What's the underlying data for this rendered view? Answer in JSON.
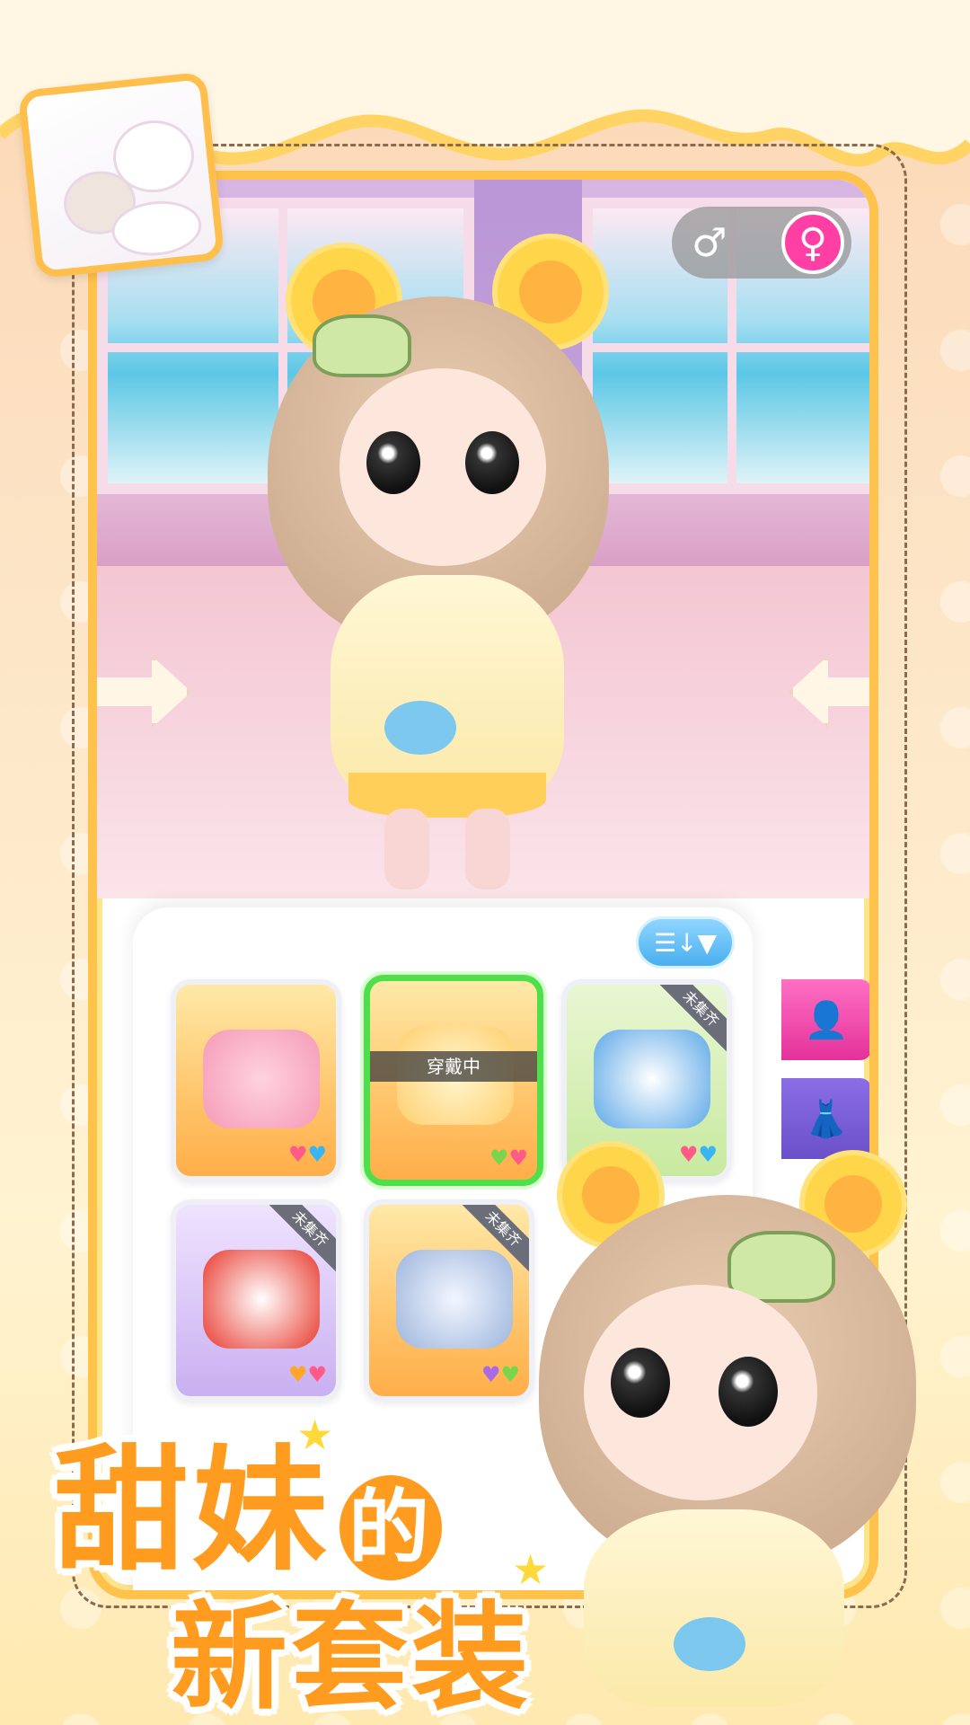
{
  "gender_toggle": {
    "male_symbol": "♂",
    "female_symbol": "♀"
  },
  "side_tabs": [
    {
      "icon": "person-icon",
      "glyph": "👤"
    },
    {
      "icon": "dress-icon",
      "glyph": "👗"
    }
  ],
  "sort_button": {
    "label": "☰↓▼"
  },
  "outfit_cards": [
    {
      "theme": "orange",
      "hearts": [
        "pink",
        "blue"
      ],
      "badge": "",
      "wearing": false
    },
    {
      "theme": "orange",
      "hearts": [
        "green",
        "pink"
      ],
      "badge": "",
      "wearing": true,
      "wearing_label": "穿戴中"
    },
    {
      "theme": "green",
      "hearts": [
        "pink",
        "blue"
      ],
      "badge": "未集齐",
      "wearing": false
    },
    {
      "theme": "purple",
      "hearts": [
        "orange",
        "pink"
      ],
      "badge": "未集齐",
      "wearing": false
    },
    {
      "theme": "orange",
      "hearts": [
        "purple",
        "green"
      ],
      "badge": "未集齐",
      "wearing": false
    }
  ],
  "headline": {
    "line1_main": "甜妹",
    "line1_small": "的",
    "line2": "新套装"
  },
  "colors": {
    "accent": "#ff9c1f",
    "frame": "#ffc24a",
    "female": "#ff3fa4",
    "selected": "#4ee04a"
  }
}
